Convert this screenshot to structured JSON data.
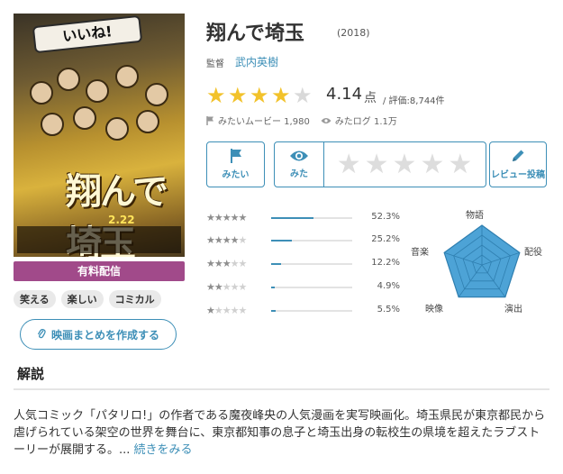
{
  "movie": {
    "title": "翔んで埼玉",
    "year": "(2018)"
  },
  "director": {
    "label": "監督",
    "name": "武内英樹"
  },
  "rating": {
    "stars_filled": 4,
    "stars_total": 5,
    "value": "4.14",
    "unit": "点",
    "count": "/ 評価:8,744件"
  },
  "stats": {
    "mitai": "みたいムービー 1,980",
    "mita": "みたログ 1.1万"
  },
  "actions": {
    "want": "みたい",
    "seen": "みた",
    "review": "レビュー投稿"
  },
  "poster": {
    "banner_text": "いいね!",
    "title_text": "翔んで埼玉",
    "date_text": "2.22"
  },
  "paid": {
    "label": "有料配信"
  },
  "tags": [
    "笑える",
    "楽しい",
    "コミカル"
  ],
  "create_summary": {
    "label": "映画まとめを作成する"
  },
  "section": {
    "title": "解説"
  },
  "description": {
    "text": "人気コミック「パタリロ!」の作者である魔夜峰央の人気漫画を実写映画化。埼玉県民が東京都民から虐げられている架空の世界を舞台に、東京都知事の息子と埼玉出身の転校生の県境を超えたラブストーリーが展開する。...",
    "more": " 続きをみる"
  },
  "distribution": [
    {
      "stars": 5,
      "pct": "52.3%",
      "fraction": 0.523
    },
    {
      "stars": 4,
      "pct": "25.2%",
      "fraction": 0.252
    },
    {
      "stars": 3,
      "pct": "12.2%",
      "fraction": 0.122
    },
    {
      "stars": 2,
      "pct": "4.9%",
      "fraction": 0.049
    },
    {
      "stars": 1,
      "pct": "5.5%",
      "fraction": 0.055
    }
  ],
  "radar": {
    "labels": [
      "物語",
      "配役",
      "演出",
      "映像",
      "音楽"
    ],
    "colors": {
      "fill": "#4da3d6",
      "stroke": "#2f7fb0",
      "grid": "#9fb9c8"
    }
  },
  "colors": {
    "accent": "#3d8fb7",
    "star": "#f2c22b",
    "paid": "#a14a8a"
  }
}
